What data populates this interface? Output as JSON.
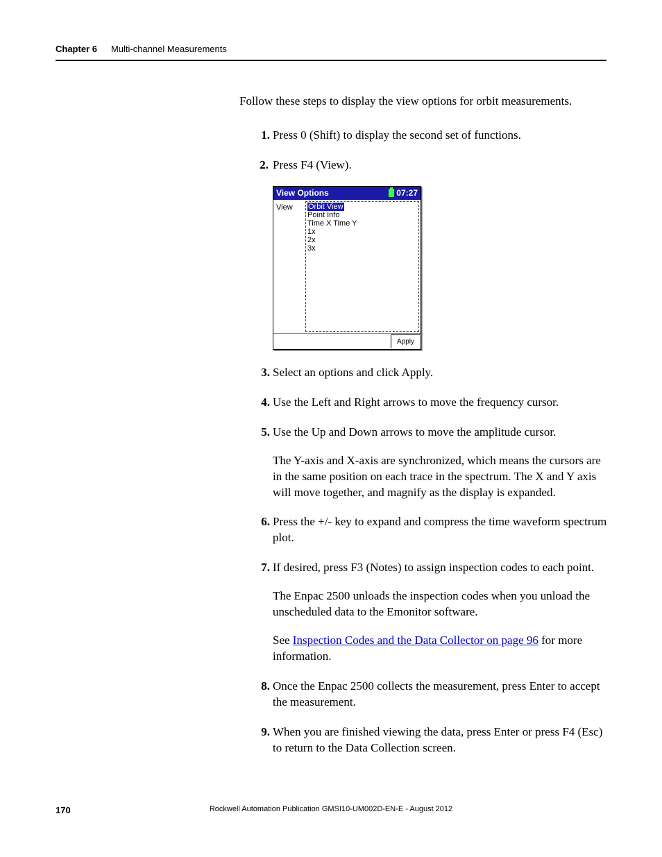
{
  "header": {
    "chapter_num": "Chapter 6",
    "chapter_title": "Multi-channel Measurements"
  },
  "intro": "Follow these steps to display the view options for orbit measurements.",
  "steps": [
    {
      "text": "Press 0 (Shift) to display the second set of functions."
    },
    {
      "text": "Press F4 (View)."
    },
    {
      "text": "Select an options and click Apply."
    },
    {
      "text": "Use the Left and Right arrows to move the frequency cursor."
    },
    {
      "text": "Use the Up and Down arrows to move the amplitude cursor.",
      "para": "The Y-axis and X-axis are synchronized, which means the cursors are in the same position on each trace in the spectrum. The X and Y axis will move together, and magnify as the display is expanded."
    },
    {
      "text": "Press the +/- key to expand and compress the time waveform spectrum plot."
    },
    {
      "text": "If desired, press F3 (Notes) to assign inspection codes to each point.",
      "para": "The Enpac 2500 unloads the inspection codes when you unload the unscheduled data to the Emonitor software.",
      "link_pre": "See ",
      "link_text": "Inspection Codes and the Data Collector on page 96",
      "link_post": " for more information."
    },
    {
      "text": "Once the Enpac 2500 collects the measurement, press Enter to accept the measurement."
    },
    {
      "text": "When you are finished viewing the data, press Enter or press F4 (Esc) to return to the Data Collection screen."
    }
  ],
  "device": {
    "title": "View Options",
    "time": "07:27",
    "view_label": "View",
    "options": [
      "Orbit View",
      "Point Info",
      "Time X Time Y",
      "1x",
      "2x",
      "3x"
    ],
    "apply": "Apply"
  },
  "footer": {
    "page": "170",
    "pub": "Rockwell Automation Publication GMSI10-UM002D-EN-E - August 2012"
  }
}
